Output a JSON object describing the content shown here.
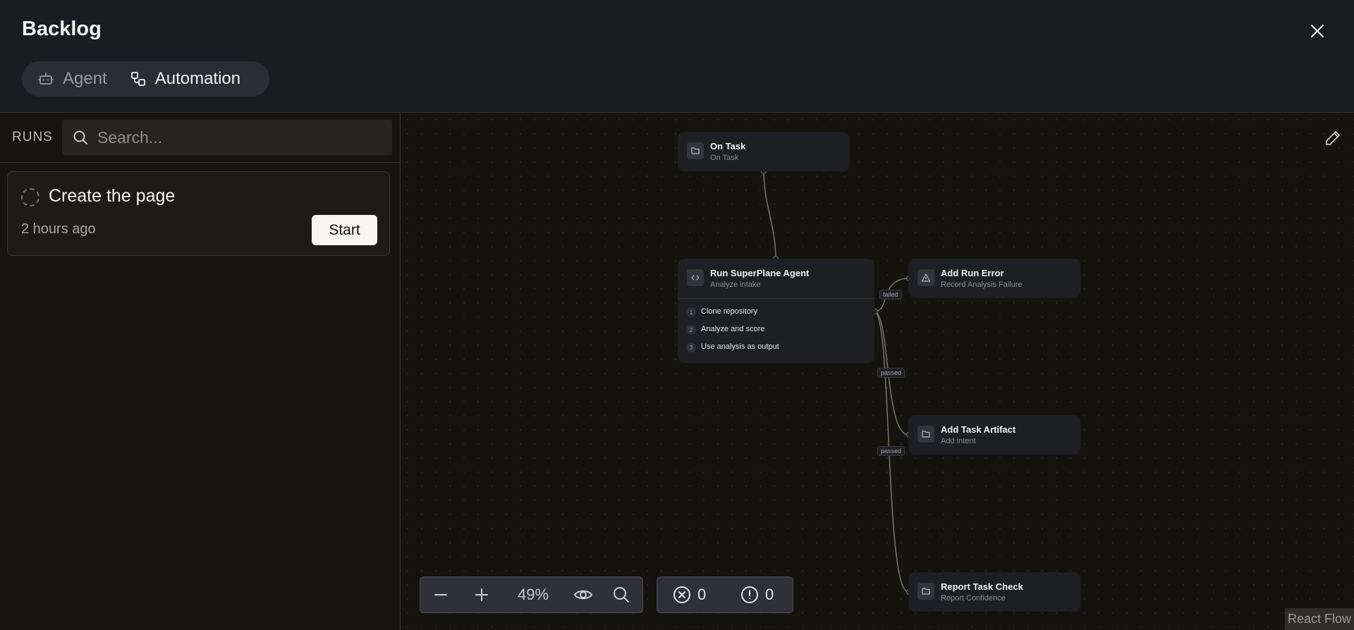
{
  "header": {
    "title": "Backlog",
    "tabs": [
      {
        "label": "Agent",
        "icon": "robot-icon",
        "active": false
      },
      {
        "label": "Automation",
        "icon": "workflow-icon",
        "active": true
      }
    ]
  },
  "runs": {
    "label": "RUNS",
    "search_placeholder": "Search...",
    "items": [
      {
        "title": "Create the page",
        "time": "2 hours ago",
        "action": "Start",
        "status": "pending"
      }
    ]
  },
  "nodes": {
    "on_task": {
      "title": "On Task",
      "subtitle": "On Task",
      "icon": "folder-icon"
    },
    "run_agent": {
      "title": "Run SuperPlane Agent",
      "subtitle": "Analyze intake",
      "icon": "code-icon",
      "steps": [
        {
          "num": "1",
          "label": "Clone repository"
        },
        {
          "num": "2",
          "label": "Analyze and score"
        },
        {
          "num": "3",
          "label": "Use analysis as output"
        }
      ]
    },
    "add_run_error": {
      "title": "Add Run Error",
      "subtitle": "Record Analysis Failure",
      "icon": "warning-icon"
    },
    "add_task_artifact": {
      "title": "Add Task Artifact",
      "subtitle": "Add intent",
      "icon": "folder-icon"
    },
    "report_task_check": {
      "title": "Report Task Check",
      "subtitle": "Report Confidence",
      "icon": "folder-icon"
    }
  },
  "edges": {
    "failed": "failed",
    "passed_1": "passed",
    "passed_2": "passed"
  },
  "controls": {
    "zoom": "49%",
    "errors": "0",
    "warnings": "0"
  },
  "attribution": "React Flow"
}
